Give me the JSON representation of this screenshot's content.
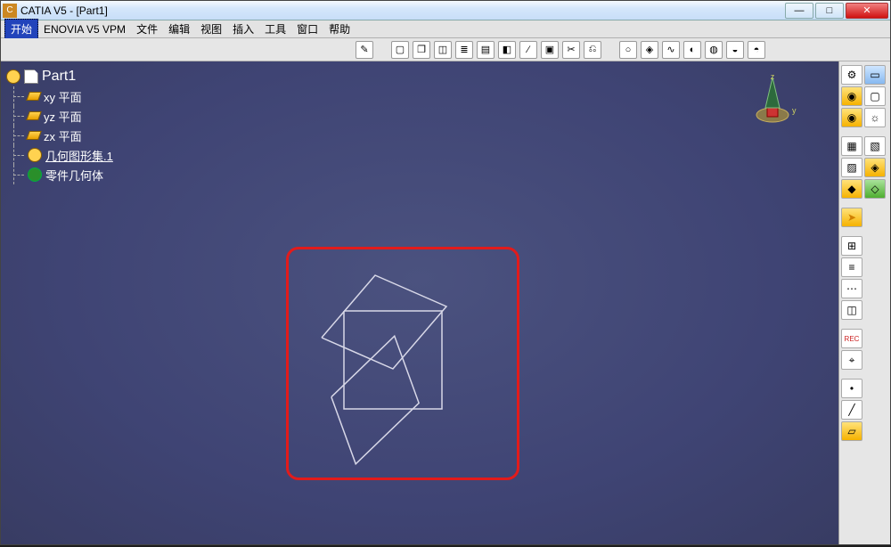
{
  "title": "CATIA V5 - [Part1]",
  "window_controls": {
    "min": "—",
    "max": "□",
    "close": "✕"
  },
  "menu": {
    "start": "开始",
    "enovia": "ENOVIA V5 VPM",
    "file": "文件",
    "edit": "编辑",
    "view": "视图",
    "insert": "插入",
    "tools": "工具",
    "window": "窗口",
    "help": "帮助"
  },
  "tree": {
    "root": "Part1",
    "items": [
      {
        "label": "xy 平面",
        "kind": "plane"
      },
      {
        "label": "yz 平面",
        "kind": "plane"
      },
      {
        "label": "zx 平面",
        "kind": "plane"
      },
      {
        "label": "几何图形集.1",
        "kind": "geoset",
        "underline": true
      },
      {
        "label": "零件几何体",
        "kind": "partbody"
      }
    ]
  },
  "compass": {
    "axis_z": "z",
    "axis_y": "y"
  },
  "accent": {
    "highlight_box": "#e21b1b",
    "bg": "#3f4474"
  }
}
